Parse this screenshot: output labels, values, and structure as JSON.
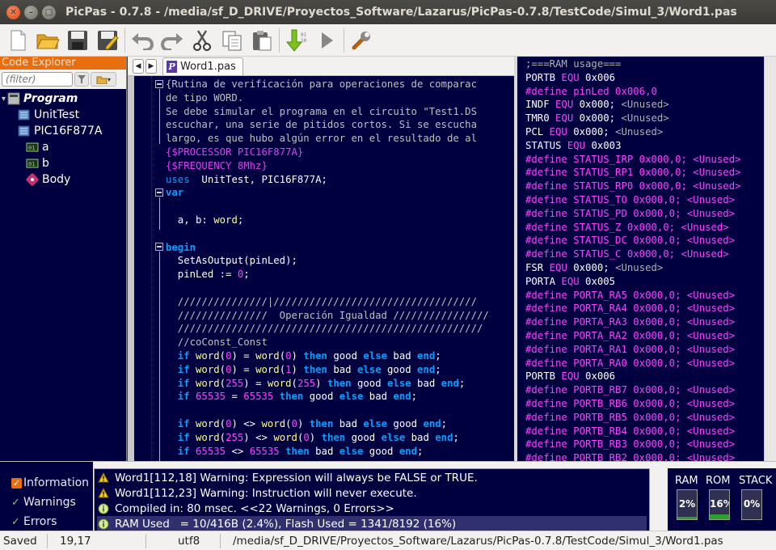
{
  "window": {
    "title": "PicPas - 0.7.8 - /media/sf_D_DRIVE/Proyectos_Software/Lazarus/PicPas-0.7.8/TestCode/Simul_3/Word1.pas"
  },
  "toolbar": {
    "icons": [
      "new-file-icon",
      "open-folder-icon",
      "save-icon",
      "save-as-icon",
      "undo-icon",
      "redo-icon",
      "cut-icon",
      "copy-icon",
      "paste-icon",
      "compile-icon",
      "run-icon",
      "settings-wrench-icon"
    ]
  },
  "explorer": {
    "header": "Code Explorer",
    "filter_placeholder": "(filter)",
    "tree": [
      {
        "label": "Program",
        "icon": "program-icon",
        "level": 0
      },
      {
        "label": "UnitTest",
        "icon": "unit-icon",
        "level": 1
      },
      {
        "label": "PIC16F877A",
        "icon": "unit-icon",
        "level": 1
      },
      {
        "label": "a",
        "icon": "variable-icon",
        "level": 1
      },
      {
        "label": "b",
        "icon": "variable-icon",
        "level": 1
      },
      {
        "label": "Body",
        "icon": "body-icon",
        "level": 1
      }
    ]
  },
  "editor": {
    "tab": "Word1.pas",
    "lines": [
      [
        [
          "cm",
          "{Rutina de verificación para operaciones de comparac"
        ]
      ],
      [
        [
          "cm",
          "de tipo WORD."
        ]
      ],
      [
        [
          "cm",
          "Se debe simular el programa en el circuito \"Test1.DS"
        ]
      ],
      [
        [
          "cm",
          "escuchar, una serie de pitidos cortos. Si se escucha"
        ]
      ],
      [
        [
          "cm",
          "largo, es que hubo algún error en el resultado de al"
        ]
      ],
      [
        [
          "dir",
          "{$PROCESSOR PIC16F877A}"
        ]
      ],
      [
        [
          "dir",
          "{$FREQUENCY 8Mhz}"
        ]
      ],
      [
        [
          "kwn",
          "uses"
        ],
        [
          "",
          "  UnitTest, PIC16F877A;"
        ]
      ],
      [
        [
          "kw",
          "var"
        ]
      ],
      [
        [
          "",
          ""
        ]
      ],
      [
        [
          "",
          "  a, b: "
        ],
        [
          "id",
          "word"
        ],
        [
          "",
          ";"
        ]
      ],
      [
        [
          "",
          ""
        ]
      ],
      [
        [
          "kw",
          "begin"
        ]
      ],
      [
        [
          "",
          "  SetAsOutput(pinLed);"
        ]
      ],
      [
        [
          "",
          "  pinLed := "
        ],
        [
          "num",
          "0"
        ],
        [
          "",
          ";"
        ]
      ],
      [
        [
          "",
          ""
        ]
      ],
      [
        [
          "cm",
          "  ///////////////|//////////////////////////////////"
        ]
      ],
      [
        [
          "cm",
          "  ///////////////  Operación Igualdad ////////////////"
        ]
      ],
      [
        [
          "cm",
          "  ///////////////////////////////////////////////////"
        ]
      ],
      [
        [
          "cm",
          "  //coConst_Const"
        ]
      ],
      [
        [
          "kw",
          "  if "
        ],
        [
          "id",
          "word"
        ],
        [
          "",
          "("
        ],
        [
          "num",
          "0"
        ],
        [
          "",
          ") = "
        ],
        [
          "id",
          "word"
        ],
        [
          "",
          "("
        ],
        [
          "num",
          "0"
        ],
        [
          "",
          ") "
        ],
        [
          "kw",
          "then"
        ],
        [
          "",
          " good "
        ],
        [
          "kw",
          "else"
        ],
        [
          "",
          " bad "
        ],
        [
          "kw",
          "end"
        ],
        [
          "",
          ";"
        ]
      ],
      [
        [
          "kw",
          "  if "
        ],
        [
          "id",
          "word"
        ],
        [
          "",
          "("
        ],
        [
          "num",
          "0"
        ],
        [
          "",
          ") = "
        ],
        [
          "id",
          "word"
        ],
        [
          "",
          "("
        ],
        [
          "num",
          "1"
        ],
        [
          "",
          ") "
        ],
        [
          "kw",
          "then"
        ],
        [
          "",
          " bad "
        ],
        [
          "kw",
          "else"
        ],
        [
          "",
          " good "
        ],
        [
          "kw",
          "end"
        ],
        [
          "",
          ";"
        ]
      ],
      [
        [
          "kw",
          "  if "
        ],
        [
          "id",
          "word"
        ],
        [
          "",
          "("
        ],
        [
          "num",
          "255"
        ],
        [
          "",
          ") = "
        ],
        [
          "id",
          "word"
        ],
        [
          "",
          "("
        ],
        [
          "num",
          "255"
        ],
        [
          "",
          ") "
        ],
        [
          "kw",
          "then"
        ],
        [
          "",
          " good "
        ],
        [
          "kw",
          "else"
        ],
        [
          "",
          " bad "
        ],
        [
          "kw",
          "end"
        ],
        [
          "",
          ";"
        ]
      ],
      [
        [
          "kw",
          "  if "
        ],
        [
          "num",
          "65535"
        ],
        [
          "",
          " = "
        ],
        [
          "num",
          "65535"
        ],
        [
          "kw",
          " then"
        ],
        [
          "",
          " good "
        ],
        [
          "kw",
          "else"
        ],
        [
          "",
          " bad "
        ],
        [
          "kw",
          "end"
        ],
        [
          "",
          ";"
        ]
      ],
      [
        [
          "",
          ""
        ]
      ],
      [
        [
          "kw",
          "  if "
        ],
        [
          "id",
          "word"
        ],
        [
          "",
          "("
        ],
        [
          "num",
          "0"
        ],
        [
          "",
          ") <> "
        ],
        [
          "id",
          "word"
        ],
        [
          "",
          "("
        ],
        [
          "num",
          "0"
        ],
        [
          "",
          ") "
        ],
        [
          "kw",
          "then"
        ],
        [
          "",
          " bad "
        ],
        [
          "kw",
          "else"
        ],
        [
          "",
          " good "
        ],
        [
          "kw",
          "end"
        ],
        [
          "",
          ";"
        ]
      ],
      [
        [
          "kw",
          "  if "
        ],
        [
          "id",
          "word"
        ],
        [
          "",
          "("
        ],
        [
          "num",
          "255"
        ],
        [
          "",
          ") <> "
        ],
        [
          "id",
          "word"
        ],
        [
          "",
          "("
        ],
        [
          "num",
          "0"
        ],
        [
          "",
          ") "
        ],
        [
          "kw",
          "then"
        ],
        [
          "",
          " good "
        ],
        [
          "kw",
          "else"
        ],
        [
          "",
          " bad "
        ],
        [
          "kw",
          "end"
        ],
        [
          "",
          ";"
        ]
      ],
      [
        [
          "kw",
          "  if "
        ],
        [
          "num",
          "65535"
        ],
        [
          "",
          " <> "
        ],
        [
          "num",
          "65535"
        ],
        [
          "kw",
          " then"
        ],
        [
          "",
          " bad "
        ],
        [
          "kw",
          "else"
        ],
        [
          "",
          " good "
        ],
        [
          "kw",
          "end"
        ],
        [
          "",
          ";"
        ]
      ]
    ]
  },
  "asm": {
    "lines": [
      [
        [
          "a-cm",
          ";===RAM usage==="
        ]
      ],
      [
        [
          "",
          "PORTB "
        ],
        [
          "a-kw",
          "EQU"
        ],
        [
          "",
          " 0x006"
        ]
      ],
      [
        [
          "a-def",
          "#define pinLed 0x006,0"
        ]
      ],
      [
        [
          "",
          "INDF "
        ],
        [
          "a-kw",
          "EQU"
        ],
        [
          "",
          " 0x000; "
        ],
        [
          "a-un",
          "<Unused>"
        ]
      ],
      [
        [
          "",
          "TMR0 "
        ],
        [
          "a-kw",
          "EQU"
        ],
        [
          "",
          " 0x000; "
        ],
        [
          "a-un",
          "<Unused>"
        ]
      ],
      [
        [
          "",
          "PCL "
        ],
        [
          "a-kw",
          "EQU"
        ],
        [
          "",
          " 0x000; "
        ],
        [
          "a-un",
          "<Unused>"
        ]
      ],
      [
        [
          "",
          "STATUS "
        ],
        [
          "a-kw",
          "EQU"
        ],
        [
          "",
          " 0x003"
        ]
      ],
      [
        [
          "a-def",
          "#define STATUS_IRP 0x000,0; <Unused>"
        ]
      ],
      [
        [
          "a-def",
          "#define STATUS_RP1 0x000,0; <Unused>"
        ]
      ],
      [
        [
          "a-def",
          "#define STATUS_RP0 0x000,0; <Unused>"
        ]
      ],
      [
        [
          "a-def",
          "#define STATUS_TO 0x000,0; <Unused>"
        ]
      ],
      [
        [
          "a-def",
          "#define STATUS_PD 0x000,0; <Unused>"
        ]
      ],
      [
        [
          "a-def",
          "#define STATUS_Z 0x000,0; <Unused>"
        ]
      ],
      [
        [
          "a-def",
          "#define STATUS_DC 0x000,0; <Unused>"
        ]
      ],
      [
        [
          "a-def",
          "#define STATUS_C 0x000,0; <Unused>"
        ]
      ],
      [
        [
          "",
          "FSR "
        ],
        [
          "a-kw",
          "EQU"
        ],
        [
          "",
          " 0x000; "
        ],
        [
          "a-un",
          "<Unused>"
        ]
      ],
      [
        [
          "",
          "PORTA "
        ],
        [
          "a-kw",
          "EQU"
        ],
        [
          "",
          " 0x005"
        ]
      ],
      [
        [
          "a-def",
          "#define PORTA_RA5 0x000,0; <Unused>"
        ]
      ],
      [
        [
          "a-def",
          "#define PORTA_RA4 0x000,0; <Unused>"
        ]
      ],
      [
        [
          "a-def",
          "#define PORTA_RA3 0x000,0; <Unused>"
        ]
      ],
      [
        [
          "a-def",
          "#define PORTA_RA2 0x000,0; <Unused>"
        ]
      ],
      [
        [
          "a-def",
          "#define PORTA_RA1 0x000,0; <Unused>"
        ]
      ],
      [
        [
          "a-def",
          "#define PORTA_RA0 0x000,0; <Unused>"
        ]
      ],
      [
        [
          "",
          "PORTB "
        ],
        [
          "a-kw",
          "EQU"
        ],
        [
          "",
          " 0x006"
        ]
      ],
      [
        [
          "a-def",
          "#define PORTB_RB7 0x000,0; <Unused>"
        ]
      ],
      [
        [
          "a-def",
          "#define PORTB_RB6 0x000,0; <Unused>"
        ]
      ],
      [
        [
          "a-def",
          "#define PORTB_RB5 0x000,0; <Unused>"
        ]
      ],
      [
        [
          "a-def",
          "#define PORTB_RB4 0x000,0; <Unused>"
        ]
      ],
      [
        [
          "a-def",
          "#define PORTB_RB3 0x000,0; <Unused>"
        ]
      ],
      [
        [
          "a-def",
          "#define PORTB_RB2 0x000,0; <Unused>"
        ]
      ]
    ]
  },
  "messages": {
    "filters": [
      {
        "label": "Information",
        "checked": "box"
      },
      {
        "label": "Warnings",
        "checked": "tick"
      },
      {
        "label": "Errors",
        "checked": "tick"
      }
    ],
    "items": [
      {
        "type": "warning",
        "text": "Word1[112,18] Warning: Expression will always be FALSE or TRUE."
      },
      {
        "type": "warning",
        "text": "Word1[112,23] Warning: Instruction will never execute."
      },
      {
        "type": "info",
        "text": "Compiled in: 80 msec. <<22 Warnings, 0 Errors>>"
      },
      {
        "type": "info",
        "text": "RAM Used   = 10/416B (2.4%), Flash Used = 1341/8192 (16%)"
      }
    ]
  },
  "meters": [
    {
      "label": "RAM",
      "value": "2%",
      "fill": 0.02
    },
    {
      "label": "ROM",
      "value": "16%",
      "fill": 0.16
    },
    {
      "label": "STACK",
      "value": "0%",
      "fill": 0
    }
  ],
  "status": {
    "state": "Saved",
    "cursor": "19,17",
    "encoding": "utf8",
    "path": "/media/sf_D_DRIVE/Proyectos_Software/Lazarus/PicPas-0.7.8/TestCode/Simul_3/Word1.pas"
  }
}
